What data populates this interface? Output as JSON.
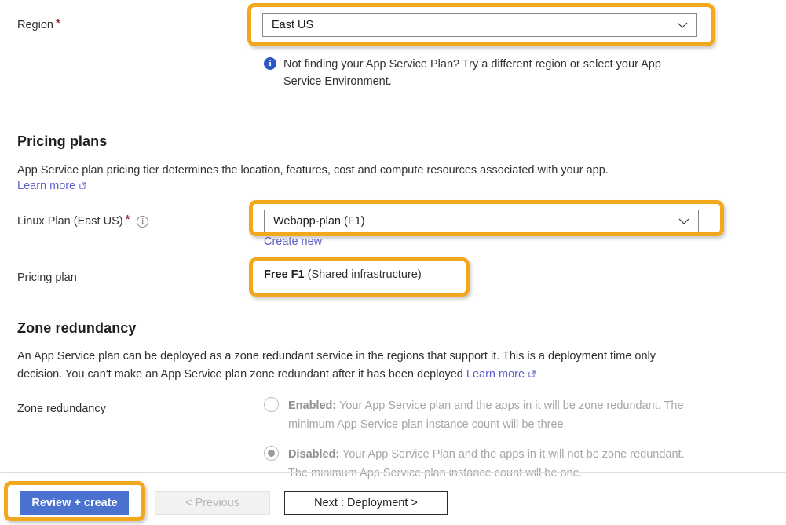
{
  "region": {
    "label": "Region",
    "required_marker": "*",
    "value": "East US",
    "note": "Not finding your App Service Plan? Try a different region or select your App Service Environment.",
    "info_glyph": "i"
  },
  "pricing_plans": {
    "heading": "Pricing plans",
    "description": "App Service plan pricing tier determines the location, features, cost and compute resources associated with your app.",
    "learn_more": "Learn more",
    "plan_field": {
      "label": "Linux Plan (East US)",
      "required_marker": "*",
      "info_glyph": "i",
      "value": "Webapp-plan (F1)",
      "create_new": "Create new"
    },
    "pricing_plan_field": {
      "label": "Pricing plan",
      "value_strong": "Free F1",
      "value_rest": "(Shared infrastructure)"
    }
  },
  "zone_redundancy": {
    "heading": "Zone redundancy",
    "description": "An App Service plan can be deployed as a zone redundant service in the regions that support it. This is a deployment time only decision. You can't make an App Service plan zone redundant after it has been deployed",
    "learn_more": "Learn more",
    "field_label": "Zone redundancy",
    "options": [
      {
        "id": "enabled",
        "title": "Enabled:",
        "description": " Your App Service plan and the apps in it will be zone redundant. The minimum App Service plan instance count will be three.",
        "selected": false
      },
      {
        "id": "disabled",
        "title": "Disabled:",
        "description": " Your App Service Plan and the apps in it will not be zone redundant. The minimum App Service plan instance count will be one.",
        "selected": true
      }
    ]
  },
  "footer": {
    "review_create": "Review + create",
    "previous": "< Previous",
    "next": "Next : Deployment >"
  },
  "colors": {
    "highlight": "#f2a81d",
    "primary_button": "#4a72ce",
    "link": "#5b5fc7",
    "required_star": "#a4262c",
    "info_badge": "#2b57c4"
  }
}
